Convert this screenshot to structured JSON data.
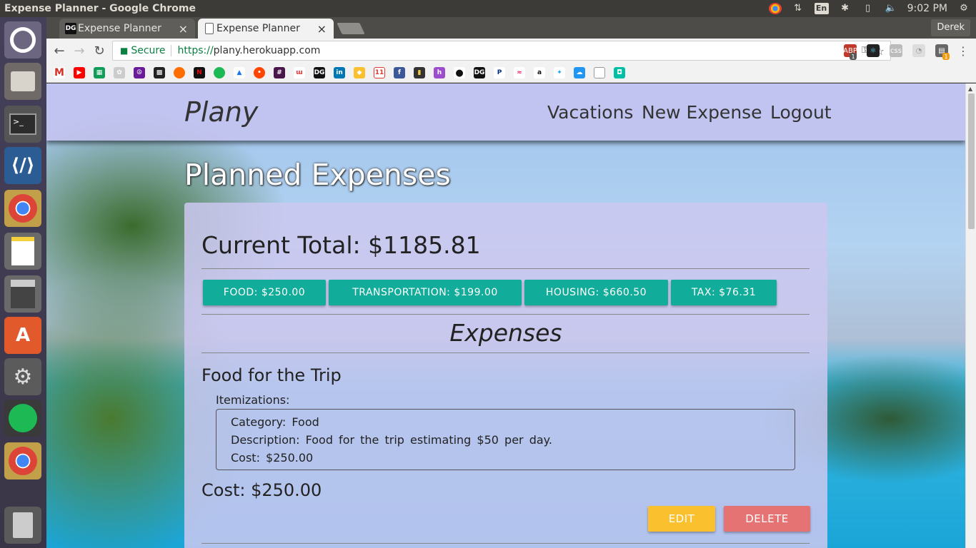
{
  "os": {
    "window_title": "Expense Planner - Google Chrome",
    "input_lang": "En",
    "clock": "9:02 PM"
  },
  "browser": {
    "tabs": [
      {
        "label": "Expense Planner",
        "favicon": "DG",
        "active": false
      },
      {
        "label": "Expense Planner",
        "favicon": "page-icon",
        "active": true
      }
    ],
    "user": "Derek",
    "security_label": "Secure",
    "url_scheme": "https://",
    "url_host": "plany.herokuapp.com",
    "extension_badges": [
      "1",
      "1"
    ]
  },
  "app": {
    "brand": "Plany",
    "nav": [
      "Vacations",
      "New Expense",
      "Logout"
    ],
    "page_title": "Planned Expenses",
    "current_total": "Current Total: $1185.81",
    "categories": [
      "FOOD: $250.00",
      "TRANSPORTATION: $199.00",
      "HOUSING: $660.50",
      "TAX: $76.31"
    ],
    "expenses_heading": "Expenses",
    "expense": {
      "name": "Food for the Trip",
      "itemizations_label": "Itemizations:",
      "category": "Category:  Food",
      "description": "Description:  Food for the trip estimating $50 per day.",
      "item_cost": "Cost:  $250.00",
      "cost": "Cost: $250.00",
      "edit_label": "EDIT",
      "delete_label": "DELETE"
    },
    "colors": {
      "chip": "#12ad9a",
      "edit": "#fbc02d",
      "delete": "#e57373"
    }
  }
}
